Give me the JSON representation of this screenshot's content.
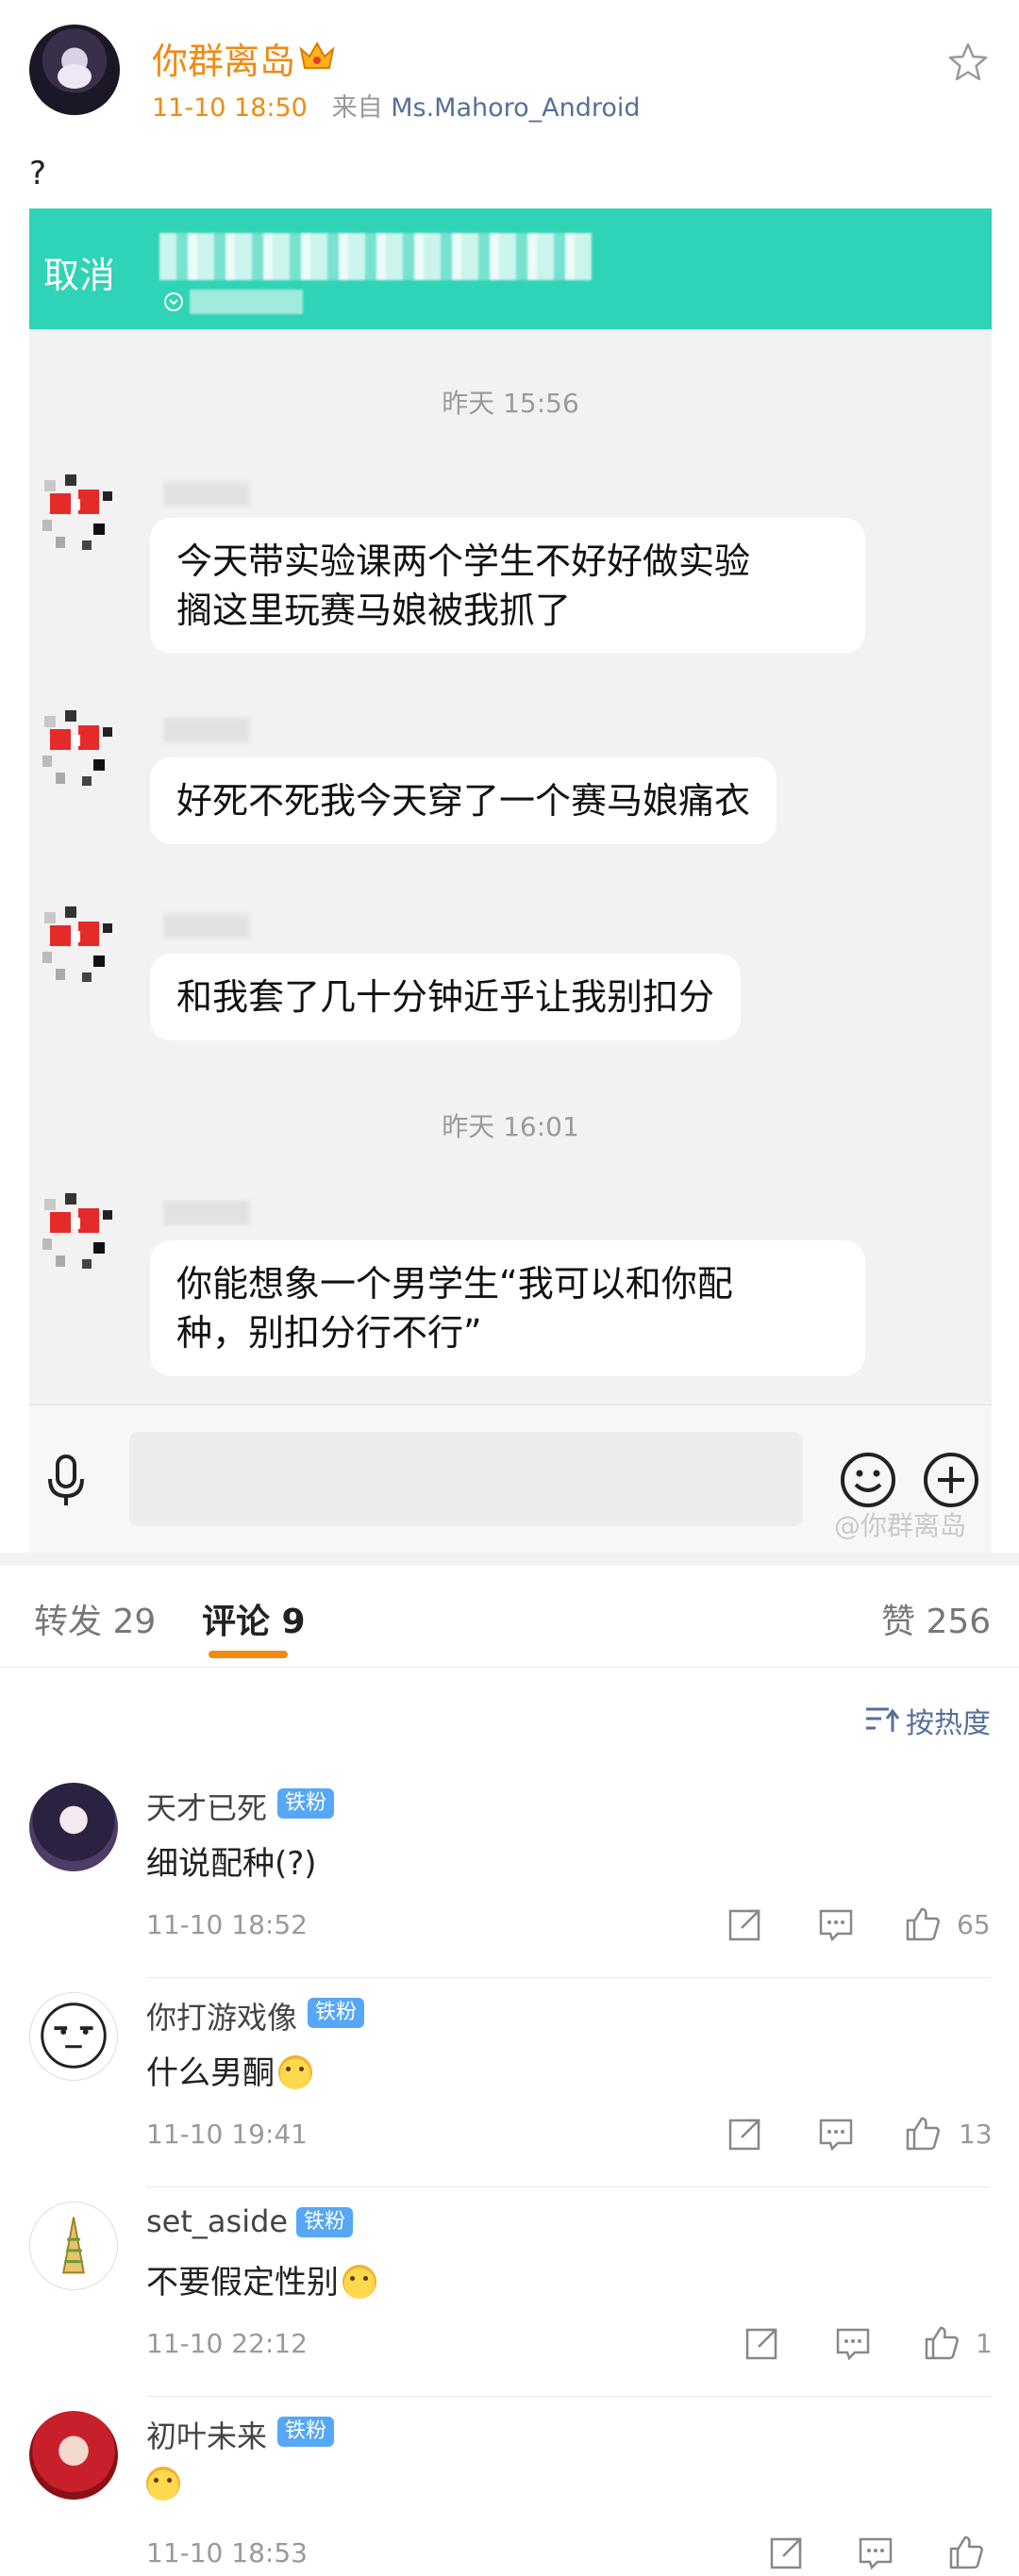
{
  "post": {
    "username": "你群离岛",
    "time": "11-10 18:50",
    "source_prefix": "来自",
    "source": "Ms.Mahoro_Android",
    "text": "?"
  },
  "chat": {
    "cancel_label": "取消",
    "dividers": [
      "昨天 15:56",
      "昨天 16:01"
    ],
    "messages": [
      {
        "text": "今天带实验课两个学生不好好做实验\n搁这里玩赛马娘被我抓了"
      },
      {
        "text": "好死不死我今天穿了一个赛马娘痛衣"
      },
      {
        "text": "和我套了几十分钟近乎让我别扣分"
      },
      {
        "text": "你能想象一个男学生“我可以和你配\n种，别扣分行不行”"
      }
    ]
  },
  "watermark": "@你群离岛",
  "tabs": {
    "reposts": "转发 29",
    "comments": "评论 9",
    "likes": "赞 256"
  },
  "sort_label": "按热度",
  "fan_badge": "铁粉",
  "comments": [
    {
      "name": "天才已死",
      "text": "细说配种(?)",
      "time": "11-10 18:52",
      "likes": "65"
    },
    {
      "name": "你打游戏像",
      "text": "什么男酮",
      "time": "11-10 19:41",
      "likes": "13"
    },
    {
      "name": "set_aside",
      "text": "不要假定性别",
      "time": "11-10 22:12",
      "likes": "1"
    },
    {
      "name": "初叶未来",
      "text": "",
      "time": "11-10 18:53",
      "likes": ""
    }
  ],
  "colors": {
    "accent": "#f08a12",
    "chat_bar": "#2fd3b5",
    "link": "#566f9a",
    "badge": "#56a7f5"
  }
}
